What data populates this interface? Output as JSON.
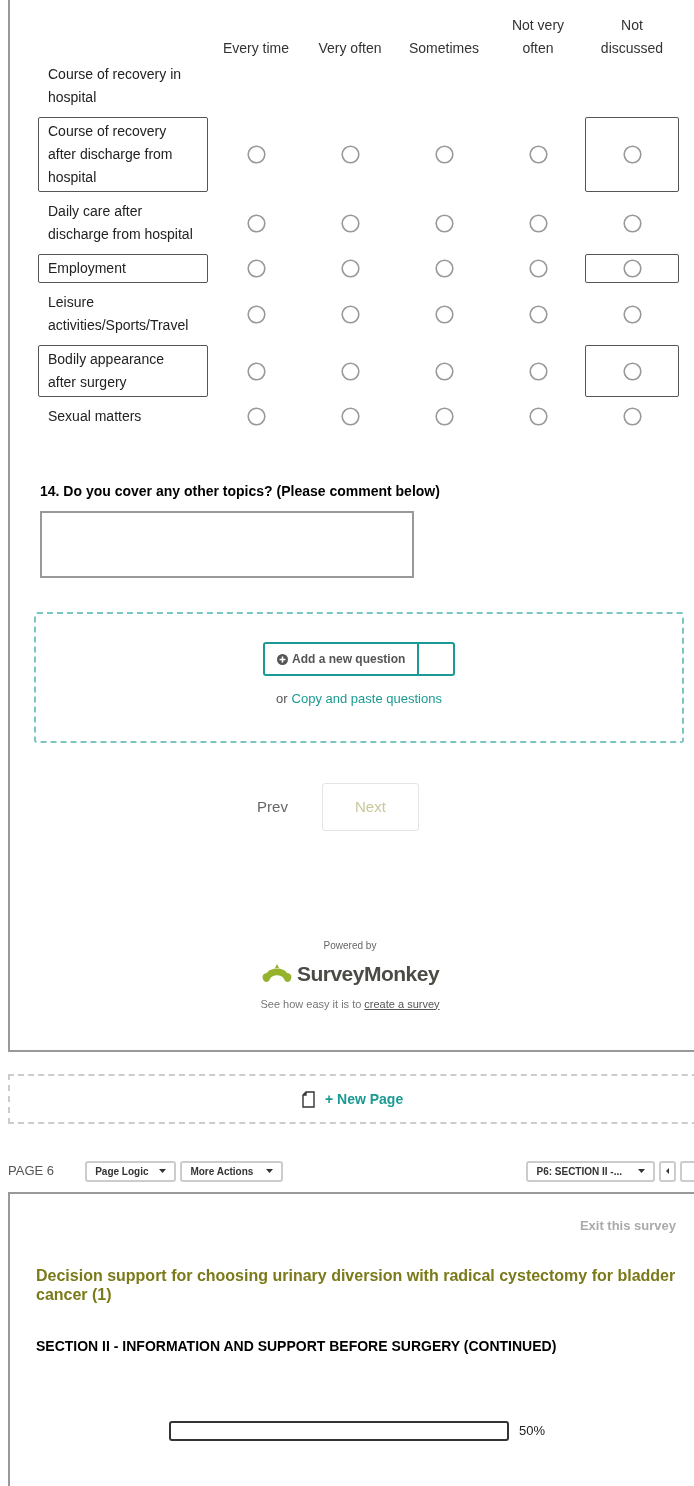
{
  "matrix": {
    "columns": [
      "Every time",
      "Very often",
      "Sometimes",
      "Not very often",
      "Not discussed"
    ],
    "rows": [
      {
        "label": "Course of recovery in hospital",
        "kind": "label_only",
        "highlighted": false
      },
      {
        "label": "Course of recovery after discharge from hospital",
        "kind": "choice",
        "highlighted": true,
        "choices": [
          {
            "selected": false
          },
          {
            "selected": false
          },
          {
            "selected": false
          },
          {
            "selected": false
          },
          {
            "selected": false
          }
        ]
      },
      {
        "label": "Daily care after discharge from hospital",
        "kind": "choice",
        "highlighted": false,
        "choices": [
          {
            "selected": false
          },
          {
            "selected": false
          },
          {
            "selected": false
          },
          {
            "selected": false
          },
          {
            "selected": false
          }
        ]
      },
      {
        "label": "Employment",
        "kind": "choice",
        "highlighted": true,
        "choices": [
          {
            "selected": false
          },
          {
            "selected": false
          },
          {
            "selected": false
          },
          {
            "selected": false
          },
          {
            "selected": false
          }
        ]
      },
      {
        "label": "Leisure activities/Sports/Travel",
        "kind": "choice",
        "highlighted": false,
        "choices": [
          {
            "selected": false
          },
          {
            "selected": false
          },
          {
            "selected": false
          },
          {
            "selected": false
          },
          {
            "selected": false
          }
        ]
      },
      {
        "label": "Bodily appearance after surgery",
        "kind": "choice",
        "highlighted": true,
        "choices": [
          {
            "selected": false
          },
          {
            "selected": false
          },
          {
            "selected": false
          },
          {
            "selected": false
          },
          {
            "selected": false
          }
        ]
      },
      {
        "label": "Sexual matters",
        "kind": "choice",
        "highlighted": false,
        "choices": [
          {
            "selected": false
          },
          {
            "selected": false
          },
          {
            "selected": false
          },
          {
            "selected": false
          },
          {
            "selected": false
          }
        ]
      }
    ]
  },
  "question": {
    "title": "14. Do you cover any other topics? (Please comment below)"
  },
  "add_question": {
    "button": "Add a new question",
    "or_text": "or",
    "link": "Copy and paste questions"
  },
  "nav": {
    "prev": "Prev",
    "next": "Next",
    "next_disabled": true
  },
  "footer": {
    "powered_by": "Powered by",
    "brand": "SurveyMonkey",
    "text": "See how easy it is to",
    "link": "create a survey"
  },
  "new_page": {
    "label": "+ New Page"
  },
  "page_bar": {
    "page": "PAGE 6",
    "buttons": [
      "Page Logic",
      "More Actions"
    ],
    "page_select": "P6: SECTION II -..."
  },
  "next_page": {
    "exit": "Exit this survey",
    "title": "Decision support for choosing urinary diversion with radical cystectomy for bladder cancer (1)",
    "section": "SECTION II - INFORMATION AND SUPPORT BEFORE SURGERY (CONTINUED)",
    "progress": {
      "level": 0,
      "reading": "50%"
    }
  }
}
